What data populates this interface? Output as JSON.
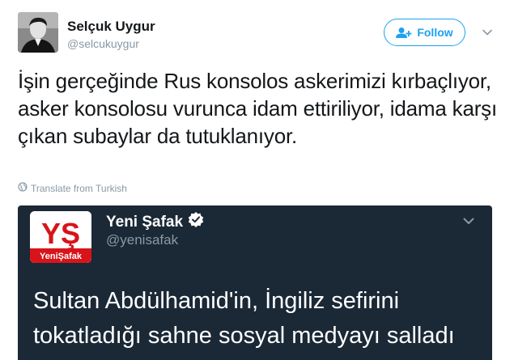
{
  "tweet": {
    "author_name": "Selçuk Uygur",
    "author_handle": "@selcukuygur",
    "follow_label": "Follow",
    "text": "İşin gerçeğinde Rus konsolos askerimizi kırbaçlıyor, asker konsolosu vurunca idam ettiriliyor, idama karşı çıkan subaylar da tutuklanıyor.",
    "translate_label": "Translate from Turkish",
    "accent_color": "#1da1f2"
  },
  "quoted": {
    "author_name": "Yeni Şafak",
    "author_handle": "@yenisafak",
    "logo_letters": "YŞ",
    "logo_wordmark": "YeniŞafak",
    "verified": true,
    "text": "Sultan Abdülhamid'in, İngiliz sefirini tokatladığı sahne sosyal medyayı salladı",
    "background_color": "#1b2836"
  }
}
